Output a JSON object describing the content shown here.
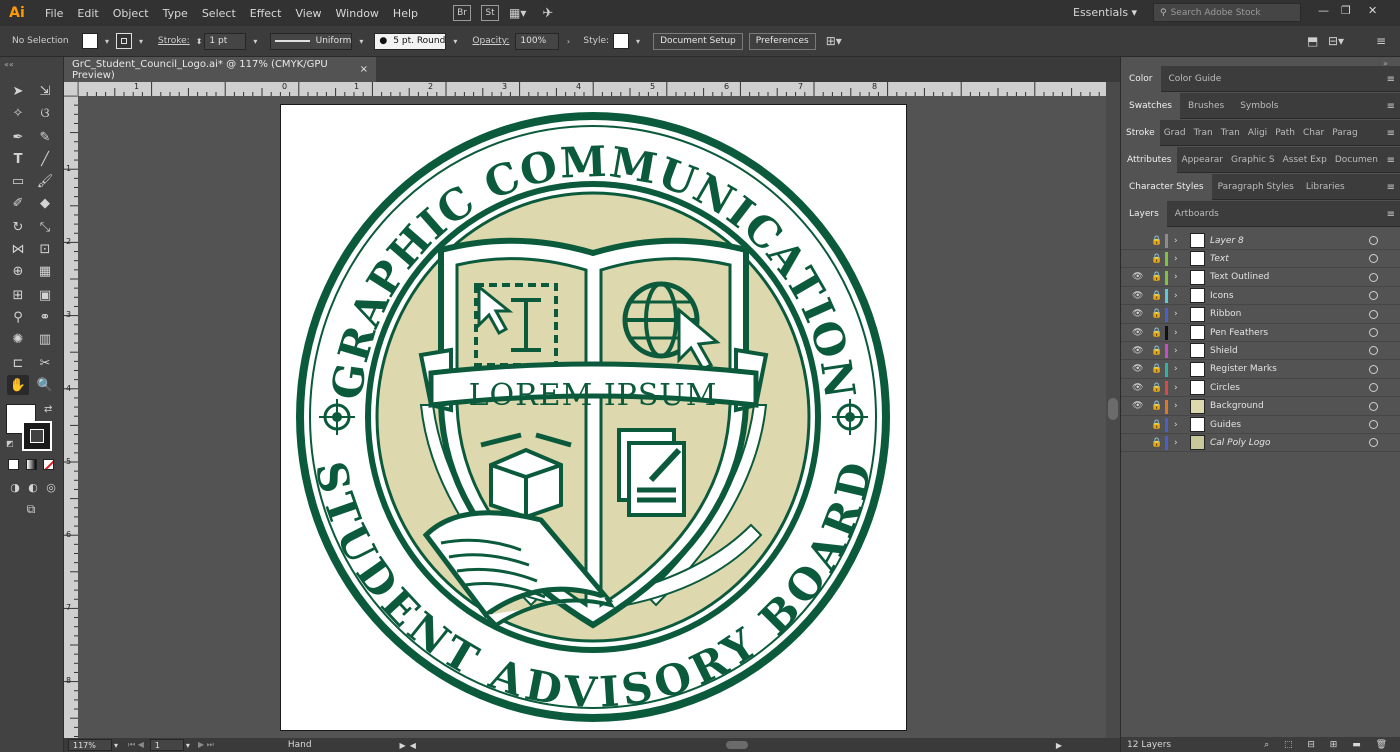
{
  "app": {
    "logo": "Ai",
    "accent": "#ff9a00"
  },
  "menubar": {
    "items": [
      "File",
      "Edit",
      "Object",
      "Type",
      "Select",
      "Effect",
      "View",
      "Window",
      "Help"
    ],
    "bridge": "Br",
    "stock": "St",
    "workspace": "Essentials",
    "search_placeholder": "Search Adobe Stock"
  },
  "controlbar": {
    "selection": "No Selection",
    "stroke_label": "Stroke:",
    "stroke_value": "1 pt",
    "profile": "Uniform",
    "brush": "5 pt. Round",
    "opacity_label": "Opacity:",
    "opacity_value": "100%",
    "style_label": "Style:",
    "doc_setup": "Document Setup",
    "preferences": "Preferences"
  },
  "document": {
    "tab_title": "GrC_Student_Council_Logo.ai* @ 117% (CMYK/GPU Preview)",
    "close": "×"
  },
  "rulers": {
    "h": [
      "1",
      "0",
      "1",
      "2",
      "3",
      "4",
      "5",
      "6",
      "7",
      "8"
    ],
    "v": [
      "1",
      "2",
      "3",
      "4",
      "5",
      "6",
      "7",
      "8"
    ]
  },
  "artwork": {
    "top_text": "GRAPHIC COMMUNICATION",
    "bottom_text": "STUDENT ADVISORY BOARD",
    "banner_text": "LOREM IPSUM",
    "colors": {
      "green": "#0b5a3c",
      "tan": "#ddd8ad",
      "white": "#ffffff"
    }
  },
  "status": {
    "zoom": "117%",
    "page": "1",
    "tool": "Hand"
  },
  "panels": {
    "row1": [
      "Color",
      "Color Guide"
    ],
    "row2": [
      "Swatches",
      "Brushes",
      "Symbols"
    ],
    "row3": [
      "Stroke",
      "Grad",
      "Tran",
      "Tran",
      "Aligi",
      "Path",
      "Char",
      "Parag"
    ],
    "row4": [
      "Attributes",
      "Appearar",
      "Graphic S",
      "Asset Exp",
      "Documen"
    ],
    "row5": [
      "Character Styles",
      "Paragraph Styles",
      "Libraries"
    ],
    "row6": [
      "Layers",
      "Artboards"
    ]
  },
  "layers": [
    {
      "name": "Layer 8",
      "visible": false,
      "color": "#8c8c8c",
      "italic": true
    },
    {
      "name": "Text",
      "visible": false,
      "color": "#7fc241",
      "italic": true
    },
    {
      "name": "Text Outlined",
      "visible": true,
      "color": "#7fc241",
      "italic": false
    },
    {
      "name": "Icons",
      "visible": true,
      "color": "#5fc8d8",
      "italic": false
    },
    {
      "name": "Ribbon",
      "visible": true,
      "color": "#4a5fc8",
      "italic": false
    },
    {
      "name": "Pen Feathers",
      "visible": true,
      "color": "#111111",
      "italic": false
    },
    {
      "name": "Shield",
      "visible": true,
      "color": "#c44fc0",
      "italic": false
    },
    {
      "name": "Register Marks",
      "visible": true,
      "color": "#2fb3a5",
      "italic": false
    },
    {
      "name": "Circles",
      "visible": true,
      "color": "#d84a4a",
      "italic": false
    },
    {
      "name": "Background",
      "visible": true,
      "color": "#e0762a",
      "italic": false
    },
    {
      "name": "Guides",
      "visible": false,
      "color": "#4a5fc8",
      "italic": false
    },
    {
      "name": "Cal Poly Logo",
      "visible": false,
      "color": "#4a5fc8",
      "italic": true
    }
  ],
  "layers_footer": "12 Layers"
}
